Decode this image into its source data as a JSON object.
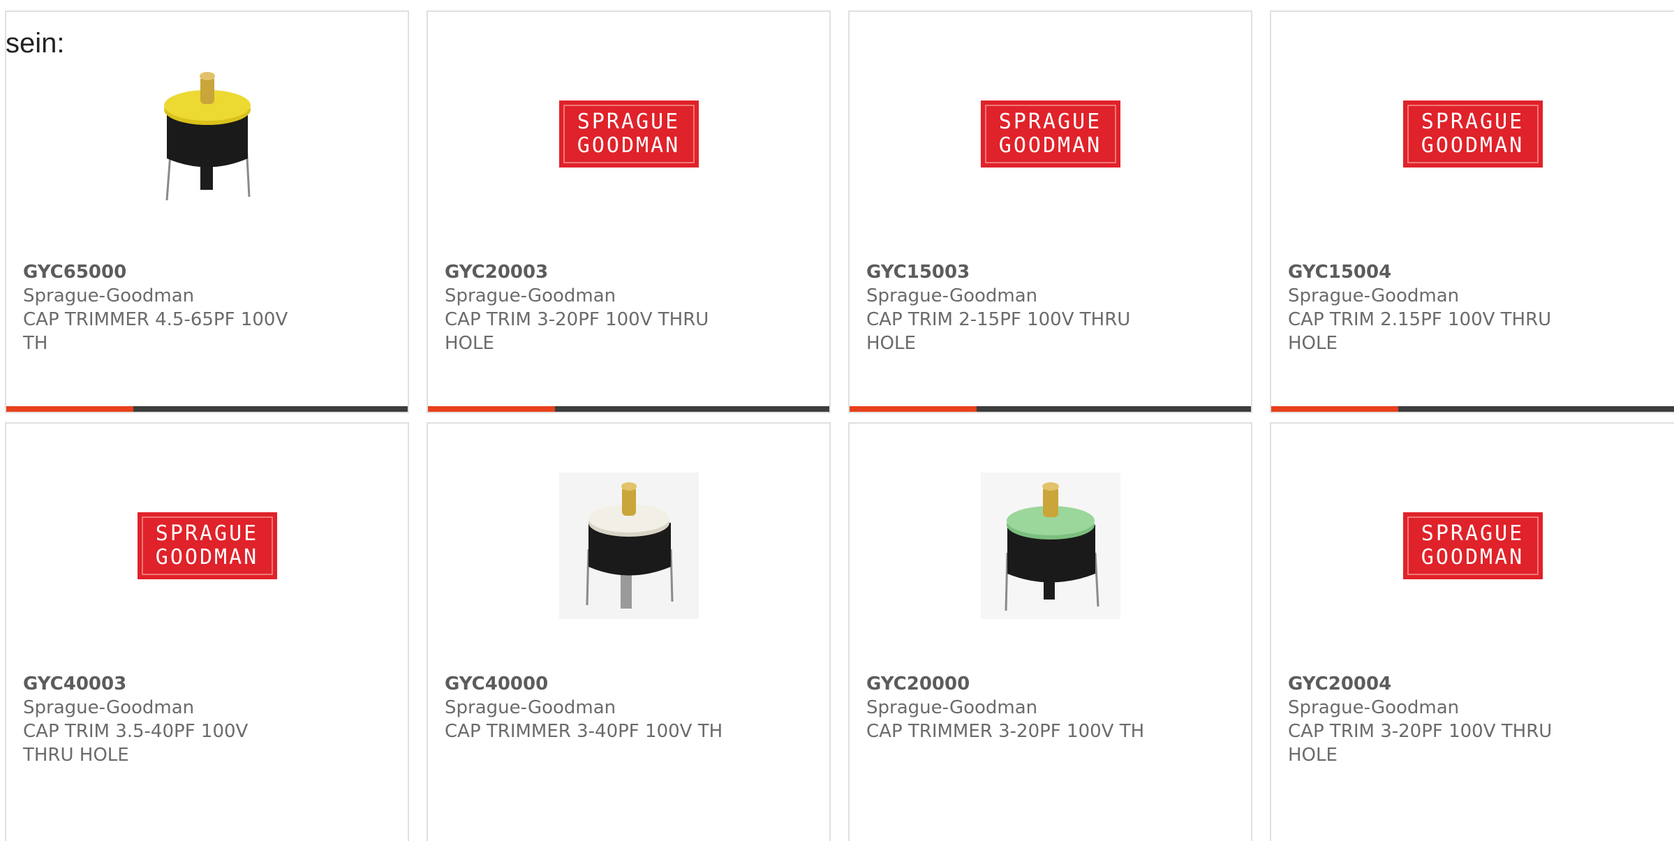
{
  "page": {
    "lead_text": "sein:"
  },
  "colors": {
    "accent": "#e8401c",
    "bar_dark": "#3d3d3d",
    "logo_red": "#e0222a"
  },
  "logo": {
    "line1": "SPRAGUE",
    "line2": "GOODMAN"
  },
  "products": [
    {
      "part": "GYC65000",
      "maker": "Sprague-Goodman",
      "desc": "CAP TRIMMER 4.5-65PF 100V TH",
      "image": "yellow-trimmer-photo"
    },
    {
      "part": "GYC20003",
      "maker": "Sprague-Goodman",
      "desc": "CAP TRIM 3-20PF 100V THRU HOLE",
      "image": "sprague-goodman-logo"
    },
    {
      "part": "GYC15003",
      "maker": "Sprague-Goodman",
      "desc": "CAP TRIM 2-15PF 100V THRU HOLE",
      "image": "sprague-goodman-logo"
    },
    {
      "part": "GYC15004",
      "maker": "Sprague-Goodman",
      "desc": "CAP TRIM 2.15PF 100V THRU HOLE",
      "image": "sprague-goodman-logo"
    },
    {
      "part": "GYC40003",
      "maker": "Sprague-Goodman",
      "desc": "CAP TRIM 3.5-40PF 100V THRU HOLE",
      "image": "sprague-goodman-logo"
    },
    {
      "part": "GYC40000",
      "maker": "Sprague-Goodman",
      "desc": "CAP TRIMMER 3-40PF 100V TH",
      "image": "white-trimmer-photo"
    },
    {
      "part": "GYC20000",
      "maker": "Sprague-Goodman",
      "desc": "CAP TRIMMER 3-20PF 100V TH",
      "image": "green-trimmer-photo"
    },
    {
      "part": "GYC20004",
      "maker": "Sprague-Goodman",
      "desc": "CAP TRIM 3-20PF 100V THRU HOLE",
      "image": "sprague-goodman-logo"
    }
  ]
}
